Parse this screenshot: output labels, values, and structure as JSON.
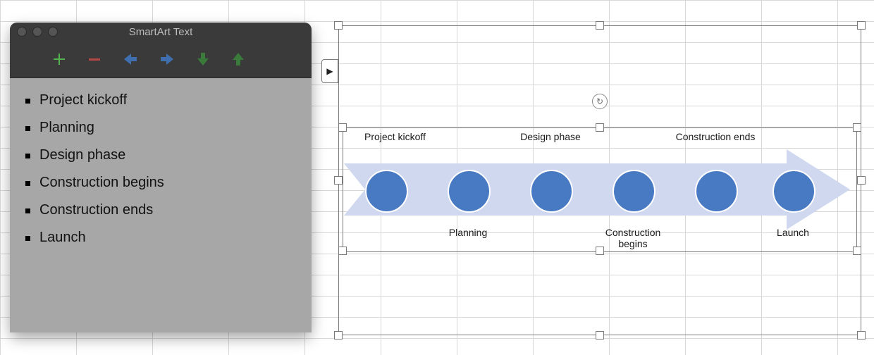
{
  "panel": {
    "title": "SmartArt Text",
    "items": [
      "Project kickoff",
      "Planning",
      "Design phase",
      "Construction begins",
      "Construction ends",
      "Launch"
    ],
    "tools": {
      "add": "add-icon",
      "remove": "remove-icon",
      "left": "arrow-left-icon",
      "right": "arrow-right-icon",
      "down": "arrow-down-icon",
      "up": "arrow-up-icon"
    }
  },
  "expander_glyph": "▶",
  "rotate_glyph": "↻",
  "smartart": {
    "colors": {
      "band": "#cfd8ef",
      "node": "#4879c3"
    },
    "steps": [
      {
        "label": "Project kickoff",
        "position": "top"
      },
      {
        "label": "Planning",
        "position": "bottom"
      },
      {
        "label": "Design phase",
        "position": "top"
      },
      {
        "label": "Construction begins",
        "position": "bottom"
      },
      {
        "label": "Construction ends",
        "position": "top"
      },
      {
        "label": "Launch",
        "position": "bottom"
      }
    ]
  }
}
